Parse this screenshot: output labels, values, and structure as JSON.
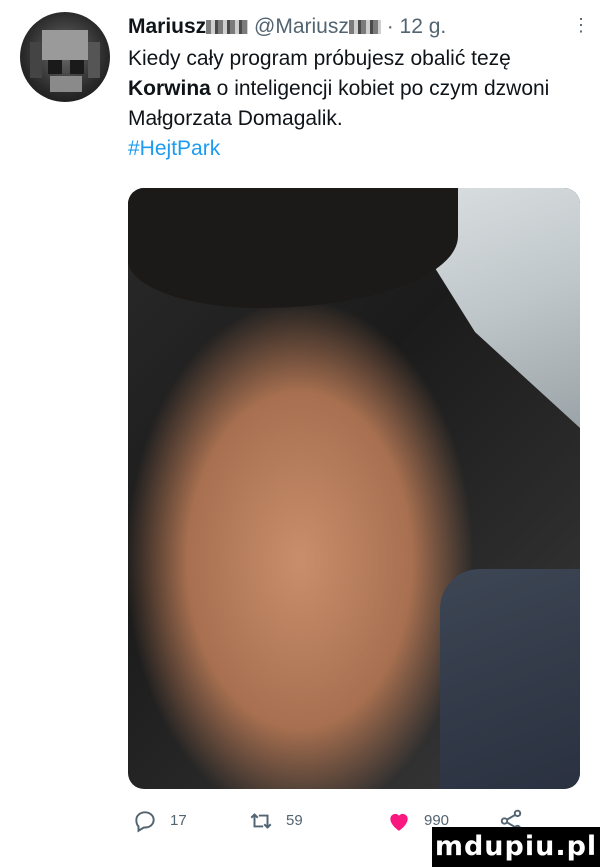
{
  "tweet": {
    "author": {
      "name": "Mariusz",
      "handle": "@Mariusz",
      "time": "· 12 g."
    },
    "more_icon": "more-dots-icon",
    "text": {
      "part1": "Kiedy cały program próbujesz obalić tezę ",
      "bold": "Korwina",
      "part2": " o inteligencji kobiet po czym dzwoni Małgorzata Domagalik.",
      "hashtag": "#HejtPark"
    },
    "media": {
      "kind": "photo"
    },
    "actions": {
      "replies": "17",
      "retweets": "59",
      "likes": "990",
      "like_color": "#f91880",
      "icons": [
        "reply-icon",
        "retweet-icon",
        "heart-icon",
        "share-icon"
      ]
    }
  },
  "watermark": "mdupiu.pl",
  "colors": {
    "text": "#0f1419",
    "secondary": "#536471",
    "link": "#1d9bf0"
  }
}
